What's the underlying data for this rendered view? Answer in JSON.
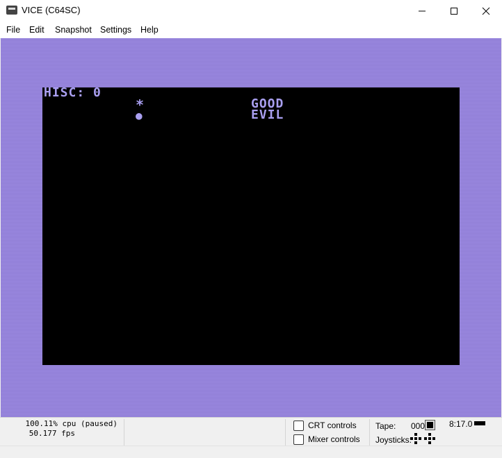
{
  "window": {
    "title": "VICE (C64SC)",
    "app_icon": "vice-icon"
  },
  "menu": [
    "File",
    "Edit",
    "Snapshot",
    "Settings",
    "Help"
  ],
  "screen": {
    "hiscore_line": "HISC: 0",
    "symbol_star": "*",
    "symbol_dot": "●",
    "label_good": "GOOD",
    "label_evil": "EVIL",
    "colors": {
      "border": "#9683df",
      "background": "#000000",
      "text": "#a99ff0"
    }
  },
  "status": {
    "cpu": "100.11% cpu (paused)",
    "fps": "50.177 fps",
    "crt_controls": "CRT controls",
    "mixer_controls": "Mixer controls",
    "tape_label": "Tape:",
    "tape_counter": "000",
    "clock": "8:17.0",
    "joysticks_label": "Joysticks:"
  }
}
